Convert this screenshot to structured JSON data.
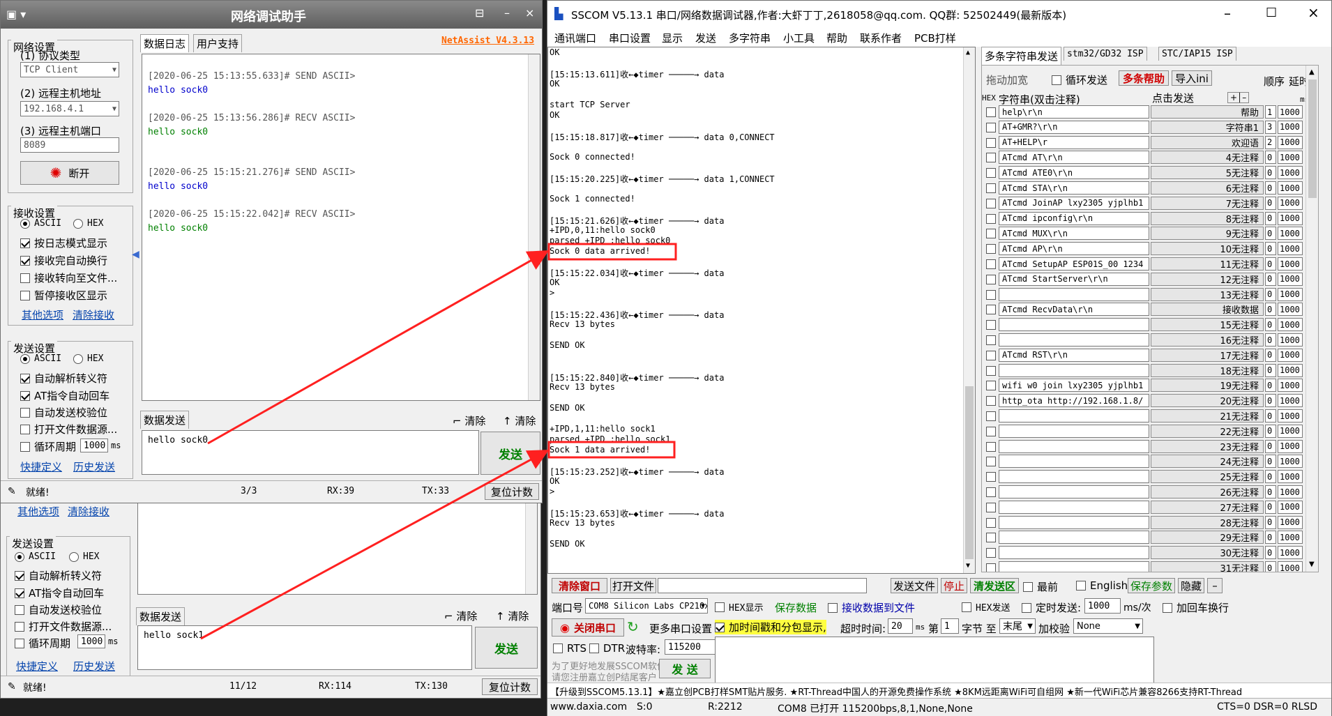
{
  "back_window": {
    "links": {
      "other_options": "其他选项",
      "clear_recv": "清除接收",
      "shortcut": "快捷定义",
      "history": "历史发送"
    },
    "send_settings_title": "发送设置",
    "ascii": "ASCII",
    "hex": "HEX",
    "options": [
      "自动解析转义符",
      "AT指令自动回车",
      "自动发送校验位",
      "打开文件数据源...",
      "循环周期"
    ],
    "cycle_value": "1000",
    "cycle_unit": "ms",
    "data_send_tab": "数据发送",
    "clear1": "清除",
    "clear2": "清除",
    "send_text": "hello sock1",
    "send_btn": "发送",
    "status": {
      "ready": "就绪!",
      "count": "11/12",
      "rx": "RX:114",
      "tx": "TX:130",
      "reset": "复位计数"
    }
  },
  "netassist": {
    "title": "网络调试助手",
    "brand": "NetAssist V4.3.13",
    "net_settings": "网络设置",
    "protocol_label": "(1) 协议类型",
    "protocol_value": "TCP Client",
    "host_label": "(2) 远程主机地址",
    "host_value": "192.168.4.1",
    "port_label": "(3) 远程主机端口",
    "port_value": "8089",
    "disconnect": "断开",
    "recv_settings": "接收设置",
    "ascii": "ASCII",
    "hex": "HEX",
    "recv_options": [
      "按日志模式显示",
      "接收完自动换行",
      "接收转向至文件...",
      "暂停接收区显示"
    ],
    "links": {
      "other_options": "其他选项",
      "clear_recv": "清除接收",
      "shortcut": "快捷定义",
      "history": "历史发送"
    },
    "send_settings": "发送设置",
    "send_options": [
      "自动解析转义符",
      "AT指令自动回车",
      "自动发送校验位",
      "打开文件数据源...",
      "循环周期"
    ],
    "cycle_value": "1000",
    "cycle_unit": "ms",
    "tabs": [
      "数据日志",
      "用户支持"
    ],
    "log": [
      {
        "head": "[2020-06-25 15:13:55.633]# SEND ASCII>",
        "body": "hello sock0",
        "kind": "send"
      },
      {
        "head": "[2020-06-25 15:13:56.286]# RECV ASCII>",
        "body": "hello sock0",
        "kind": "recv"
      },
      {
        "head": "[2020-06-25 15:15:21.276]# SEND ASCII>",
        "body": "hello sock0",
        "kind": "send"
      },
      {
        "head": "[2020-06-25 15:15:22.042]# RECV ASCII>",
        "body": "hello sock0",
        "kind": "recv"
      }
    ],
    "data_send_tab": "数据发送",
    "clear1": "清除",
    "clear2": "清除",
    "send_text": "hello sock0",
    "send_btn": "发送",
    "status": {
      "ready": "就绪!",
      "count": "3/3",
      "rx": "RX:39",
      "tx": "TX:33",
      "reset": "复位计数"
    }
  },
  "sscom": {
    "title": "SSCOM V5.13.1 串口/网络数据调试器,作者:大虾丁丁,2618058@qq.com. QQ群: 52502449(最新版本)",
    "menus": [
      "通讯端口",
      "串口设置",
      "显示",
      "发送",
      "多字符串",
      "小工具",
      "帮助",
      "联系作者",
      "PCB打样"
    ],
    "log": [
      "OK",
      "",
      "[15:15:13.611]收←◆timer ─────→ data",
      "OK",
      "",
      "start TCP Server",
      "OK",
      "",
      "[15:15:18.817]收←◆timer ─────→ data 0,CONNECT",
      "",
      "Sock 0 connected!",
      "",
      "[15:15:20.225]收←◆timer ─────→ data 1,CONNECT",
      "",
      "Sock 1 connected!",
      "",
      "[15:15:21.626]收←◆timer ─────→ data",
      "+IPD,0,11:hello sock0",
      "parsed +IPD :hello sock0",
      "Sock 0 data arrived!",
      "",
      "[15:15:22.034]收←◆timer ─────→ data",
      "OK",
      ">",
      "",
      "[15:15:22.436]收←◆timer ─────→ data",
      "Recv 13 bytes",
      "",
      "SEND OK",
      "",
      "",
      "[15:15:22.840]收←◆timer ─────→ data",
      "Recv 13 bytes",
      "",
      "SEND OK",
      "",
      "+IPD,1,11:hello sock1",
      "parsed +IPD :hello sock1",
      "Sock 1 data arrived!",
      "",
      "[15:15:23.252]收←◆timer ─────→ data",
      "OK",
      ">",
      "",
      "[15:15:23.653]收←◆timer ─────→ data",
      "Recv 13 bytes",
      "",
      "SEND OK"
    ],
    "right_tabs": [
      "多条字符串发送",
      "stm32/GD32 ISP",
      "STC/IAP15 ISP"
    ],
    "drag_widen": "拖动加宽",
    "loop_send": "循环发送",
    "multi_help": "多条帮助",
    "import_ini": "导入ini",
    "col_hex": "HEX",
    "col_str": "字符串(双击注释)",
    "col_click": "点击发送",
    "col_order": "顺序",
    "col_delay": "延时",
    "col_ms": "ms",
    "rows": [
      {
        "s": "help\\r\\n",
        "b": "帮助",
        "o": "1",
        "d": "1000"
      },
      {
        "s": "AT+GMR?\\r\\n",
        "b": "字符串1",
        "o": "3",
        "d": "1000"
      },
      {
        "s": "AT+HELP\\r",
        "b": "欢迎语",
        "o": "2",
        "d": "1000"
      },
      {
        "s": "ATcmd AT\\r\\n",
        "b": "4无注释",
        "o": "0",
        "d": "1000"
      },
      {
        "s": "ATcmd ATE0\\r\\n",
        "b": "5无注释",
        "o": "0",
        "d": "1000"
      },
      {
        "s": "ATcmd STA\\r\\n",
        "b": "6无注释",
        "o": "0",
        "d": "1000"
      },
      {
        "s": "ATcmd JoinAP lxy2305 yjplhb1",
        "b": "7无注释",
        "o": "0",
        "d": "1000"
      },
      {
        "s": "ATcmd ipconfig\\r\\n",
        "b": "8无注释",
        "o": "0",
        "d": "1000"
      },
      {
        "s": "ATcmd MUX\\r\\n",
        "b": "9无注释",
        "o": "0",
        "d": "1000"
      },
      {
        "s": "ATcmd AP\\r\\n",
        "b": "10无注释",
        "o": "0",
        "d": "1000"
      },
      {
        "s": "ATcmd SetupAP ESP01S_00 1234",
        "b": "11无注释",
        "o": "0",
        "d": "1000"
      },
      {
        "s": "ATcmd StartServer\\r\\n",
        "b": "12无注释",
        "o": "0",
        "d": "1000"
      },
      {
        "s": "",
        "b": "13无注释",
        "o": "0",
        "d": "1000"
      },
      {
        "s": "ATcmd RecvData\\r\\n",
        "b": "接收数据",
        "o": "0",
        "d": "1000"
      },
      {
        "s": "",
        "b": "15无注释",
        "o": "0",
        "d": "1000"
      },
      {
        "s": "",
        "b": "16无注释",
        "o": "0",
        "d": "1000"
      },
      {
        "s": "ATcmd RST\\r\\n",
        "b": "17无注释",
        "o": "0",
        "d": "1000"
      },
      {
        "s": "",
        "b": "18无注释",
        "o": "0",
        "d": "1000"
      },
      {
        "s": "wifi w0 join lxy2305 yjplhb1",
        "b": "19无注释",
        "o": "0",
        "d": "1000"
      },
      {
        "s": "http_ota http://192.168.1.8/",
        "b": "20无注释",
        "o": "0",
        "d": "1000"
      },
      {
        "s": "",
        "b": "21无注释",
        "o": "0",
        "d": "1000"
      },
      {
        "s": "",
        "b": "22无注释",
        "o": "0",
        "d": "1000"
      },
      {
        "s": "",
        "b": "23无注释",
        "o": "0",
        "d": "1000"
      },
      {
        "s": "",
        "b": "24无注释",
        "o": "0",
        "d": "1000"
      },
      {
        "s": "",
        "b": "25无注释",
        "o": "0",
        "d": "1000"
      },
      {
        "s": "",
        "b": "26无注释",
        "o": "0",
        "d": "1000"
      },
      {
        "s": "",
        "b": "27无注释",
        "o": "0",
        "d": "1000"
      },
      {
        "s": "",
        "b": "28无注释",
        "o": "0",
        "d": "1000"
      },
      {
        "s": "",
        "b": "29无注释",
        "o": "0",
        "d": "1000"
      },
      {
        "s": "",
        "b": "30无注释",
        "o": "0",
        "d": "1000"
      },
      {
        "s": "",
        "b": "31无注释",
        "o": "0",
        "d": "1000"
      }
    ],
    "clear_window": "清除窗口",
    "open_file": "打开文件",
    "send_file": "发送文件",
    "stop": "停止",
    "clear_send": "清发送区",
    "latest": "最前",
    "english": "English",
    "save_params": "保存参数",
    "hide": "隐藏",
    "port_label": "端口号",
    "port_value": "COM8 Silicon Labs CP210x U",
    "hex_display": "HEX显示",
    "save_data": "保存数据",
    "recv_to_file": "接收数据到文件",
    "hex_send": "HEX发送",
    "timed_send": "定时发送:",
    "timed_value": "1000",
    "timed_unit": "ms/次",
    "add_newline": "加回车换行",
    "close_port": "关闭串口",
    "more_port": "更多串口设置",
    "timestamp": "加时间戳和分包显示,",
    "timeout_label": "超时时间:",
    "timeout_value": "20",
    "timeout_unit": "ms",
    "nth_label": "第",
    "nth_value": "1",
    "byte_to": "字节 至",
    "tail": "末尾",
    "checksum": "加校验",
    "checksum_value": "None",
    "rts": "RTS",
    "dtr": "DTR",
    "baud_label": "波特率:",
    "baud_value": "115200",
    "promo1": "为了更好地发展SSCOM软件",
    "promo2": "请您注册嘉立创P结尾客户",
    "send_btn": "发 送",
    "ad": "【升级到SSCOM5.13.1】★嘉立创PCB打样SMT贴片服务. ★RT-Thread中国人的开源免费操作系统 ★8KM远距离WiFi可自组网 ★新一代WiFi芯片兼容8266支持RT-Thread",
    "status": {
      "site": "www.daxia.com",
      "s": "S:0",
      "r": "R:2212",
      "port": "COM8 已打开  115200bps,8,1,None,None",
      "cts": "CTS=0 DSR=0 RLSD"
    }
  },
  "colors": {
    "send_blue": "#0000cc",
    "recv_green": "#008000",
    "annotation_red": "#ff2020",
    "brand_orange": "#ff6600"
  }
}
